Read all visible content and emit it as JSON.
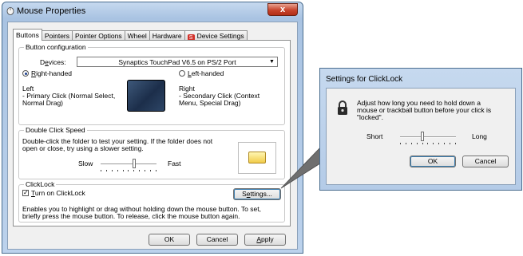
{
  "window": {
    "title": "Mouse Properties",
    "close_symbol": "x",
    "tabs": [
      {
        "label": "Buttons",
        "active": true
      },
      {
        "label": "Pointers"
      },
      {
        "label": "Pointer Options"
      },
      {
        "label": "Wheel"
      },
      {
        "label": "Hardware"
      },
      {
        "label": "Device Settings",
        "icon": "synaptics-device-icon"
      }
    ],
    "button_config": {
      "group_title": "Button configuration",
      "devices_label": "Devices:",
      "device_value": "Synaptics TouchPad V6.5 on PS/2 Port",
      "right_handed_label": "Right-handed",
      "left_handed_label": "Left-handed",
      "selected": "right",
      "left_title": "Left",
      "left_desc_1": "- Primary Click (Normal Select,",
      "left_desc_2": "Normal Drag)",
      "right_title": "Right",
      "right_desc_1": "- Secondary Click (Context",
      "right_desc_2": "Menu, Special Drag)"
    },
    "double_click": {
      "group_title": "Double Click Speed",
      "desc_1": "Double-click the folder to test your setting.  If the folder does not",
      "desc_2": "open or close, try using a slower setting.",
      "slow_label": "Slow",
      "fast_label": "Fast",
      "speed_fraction": 0.6
    },
    "clicklock": {
      "group_title": "ClickLock",
      "checkbox_label": "Turn on ClickLock",
      "checked": true,
      "settings_button": "Settings...",
      "desc_1": "Enables you to highlight or drag without holding down the mouse button.  To set,",
      "desc_2": "briefly press the mouse button.  To release, click the mouse button again."
    },
    "buttons": {
      "ok": "OK",
      "cancel": "Cancel",
      "apply": "Apply"
    }
  },
  "clicklock_dialog": {
    "title": "Settings for ClickLock",
    "desc_1": "Adjust how long you need to hold down a",
    "desc_2": "mouse or trackball button before your click is",
    "desc_3": "\"locked\".",
    "short_label": "Short",
    "long_label": "Long",
    "time_fraction": 0.4,
    "ok": "OK",
    "cancel": "Cancel"
  },
  "colors": {
    "accent": "#3c7fb1",
    "close_red": "#c8442c",
    "window_frame": "#a9c3e2"
  }
}
